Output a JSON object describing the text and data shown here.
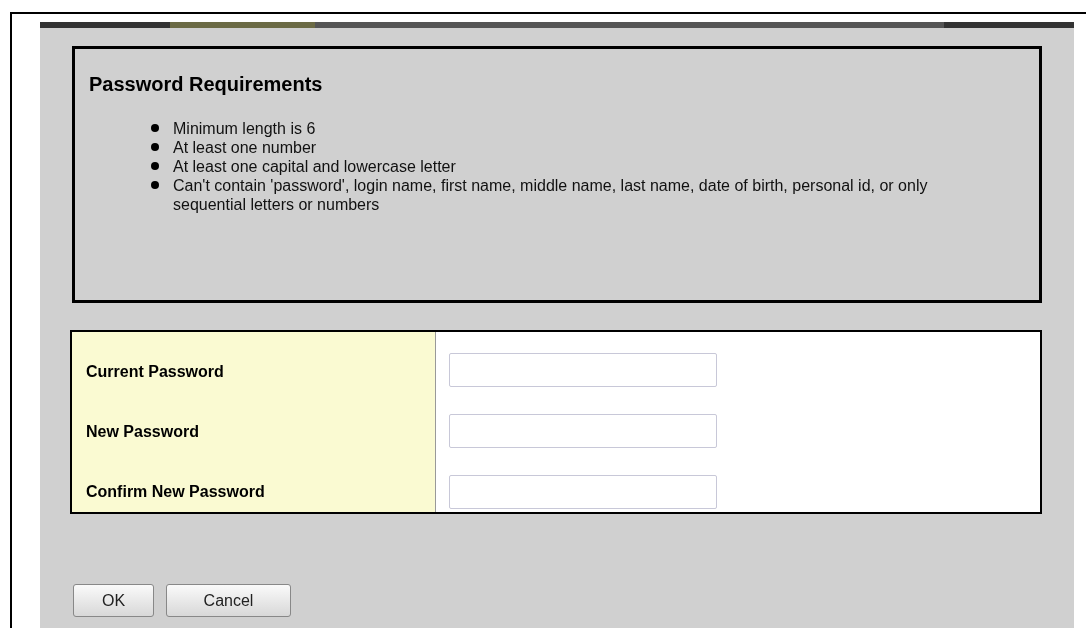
{
  "requirements": {
    "title": "Password Requirements",
    "items": [
      "Minimum length is 6",
      "At least one number",
      "At least one capital and lowercase letter",
      "Can't contain 'password', login name, first name, middle name, last name, date of birth, personal id, or only sequential letters or numbers"
    ]
  },
  "fields": [
    {
      "label": "Current Password"
    },
    {
      "label": "New Password"
    },
    {
      "label": "Confirm New Password"
    }
  ],
  "buttons": [
    "OK",
    "Cancel"
  ]
}
